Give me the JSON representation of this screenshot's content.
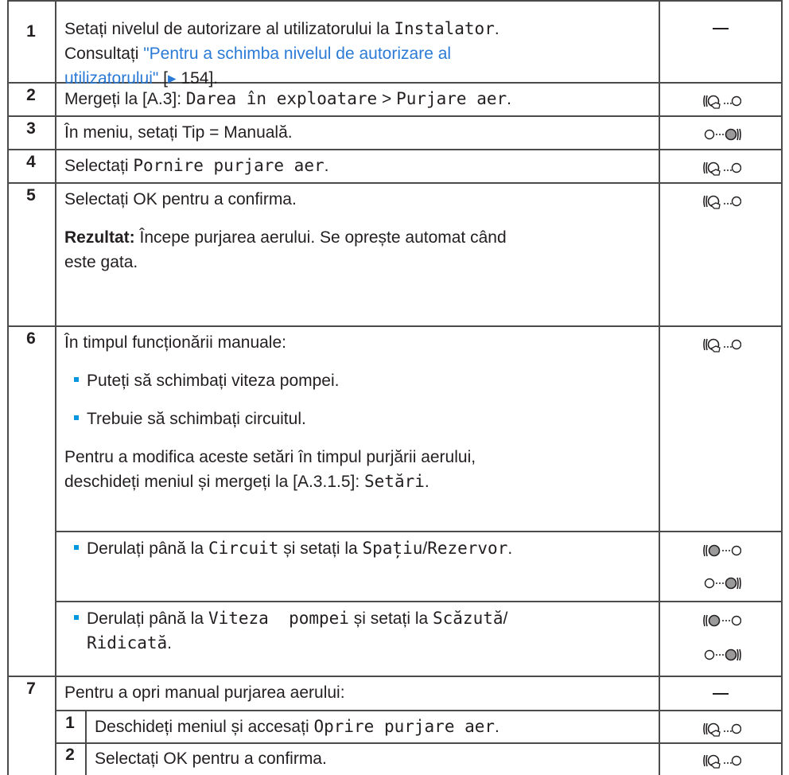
{
  "rows": {
    "r1": {
      "num": "1",
      "line1_pre": "Setați nivelul de autorizare al utilizatorului la ",
      "line1_mono": "Instalator",
      "line1_post": ".",
      "line2": "Consultați ",
      "link_a": "\"Pentru a schimba nivelul de autorizare al",
      "link_b": "utilizatorului\"",
      "ref_pre": " [",
      "ref_page": " 154",
      "ref_post": "]."
    },
    "r2": {
      "num": "2",
      "pre": "Mergeți la [A.3]: ",
      "mono1": "Darea în exploatare",
      "sep": " > ",
      "mono2": "Purjare aer",
      "post": "."
    },
    "r3": {
      "num": "3",
      "pre": "În meniu, setați ",
      "k": "Tip",
      "eq": " = ",
      "v": "Manuală",
      "post": "."
    },
    "r4": {
      "num": "4",
      "pre": "Selectați ",
      "mono": "Pornire purjare aer",
      "post": "."
    },
    "r5": {
      "num": "5",
      "pre": "Selectați ",
      "ok": "OK",
      "post": " pentru a confirma.",
      "result_label": "Rezultat:",
      "result_1": " Începe purjarea aerului. Se oprește automat când",
      "result_2": "este gata."
    },
    "r6": {
      "num": "6",
      "intro": "În timpul funcționării manuale:",
      "b1": "Puteți să schimbați viteza pompei.",
      "b2": "Trebuie să schimbați circuitul.",
      "p1": "Pentru a modifica aceste setări în timpul purjării aerului,",
      "p2_pre": "deschideți meniul și mergeți la [A.3.1.5]: ",
      "p2_mono": "Setări",
      "p2_post": ".",
      "s1_pre": "Derulați până la ",
      "s1_m1": "Circuit",
      "s1_mid": " și setați la ",
      "s1_m2": "Spațiu",
      "s1_slash": "/",
      "s1_m3": "Rezervor",
      "s1_post": ".",
      "s2_pre": "Derulați până la ",
      "s2_m1": "Viteza  pompei",
      "s2_mid": " și setați la ",
      "s2_m2": "Scăzută",
      "s2_slash": "/",
      "s2_m3": "Ridicată",
      "s2_post": "."
    },
    "r7": {
      "num": "7",
      "intro": "Pentru a opri manual purjarea aerului:",
      "sub1_num": "1",
      "sub1_pre": "Deschideți meniul și accesați ",
      "sub1_mono": "Oprire purjare aer",
      "sub1_post": ".",
      "sub2_num": "2",
      "sub2_pre": "Selectați ",
      "sub2_ok": "OK",
      "sub2_post": " pentru a confirma."
    }
  },
  "icons": {
    "dial_press": "dial-press-icon",
    "dial_left": "dial-left-turn-icon",
    "dial_right": "dial-right-turn-icon",
    "none": "em-dash"
  },
  "colors": {
    "link": "#2b7bd6",
    "bullet": "#0097e0",
    "text": "#231f20",
    "grid": "#4b4b4b"
  }
}
